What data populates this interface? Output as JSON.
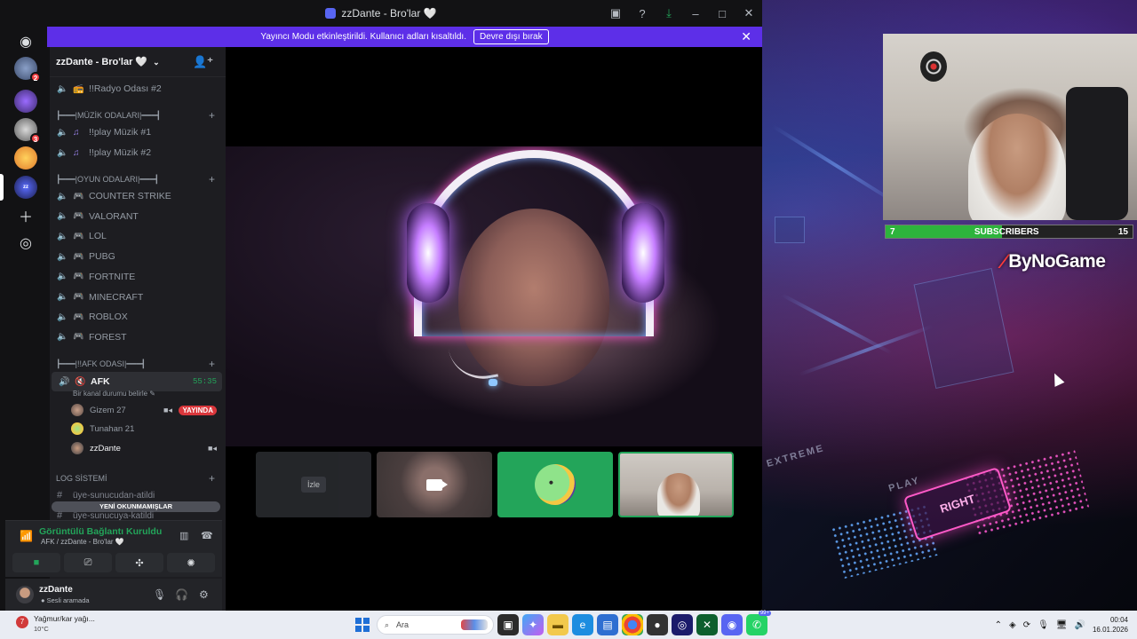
{
  "window": {
    "title": "zzDante - Bro'lar 🤍",
    "controls": [
      "inbox-icon",
      "help-icon",
      "download-icon",
      "minimize-icon",
      "maximize-icon",
      "close-icon"
    ]
  },
  "banner": {
    "message": "Yayıncı Modu etkinleştirildi. Kullanıcı adları kısaltıldı.",
    "button": "Devre dışı bırak",
    "close": "✕"
  },
  "guilds": {
    "items": [
      {
        "name": "server-1",
        "badge": "2"
      },
      {
        "name": "server-2",
        "badge": ""
      },
      {
        "name": "server-3",
        "badge": "3"
      },
      {
        "name": "server-4",
        "badge": ""
      },
      {
        "name": "server-zzdante",
        "badge": ""
      }
    ]
  },
  "server": {
    "name": "zzDante - Bro'lar 🤍",
    "chevron": "⌄"
  },
  "channels": {
    "radyo": "!!Radyo Odası #2",
    "cat_muzik": "┣━━━|MÜZİK ODALARI|━━━┫",
    "muzik1": "!!play Müzik #1",
    "muzik2": "!!play Müzik #2",
    "cat_oyun": "┣━━━|OYUN ODALARI|━━━┫",
    "games": [
      "COUNTER STRIKE",
      "VALORANT",
      "LOL",
      "PUBG",
      "FORTNITE",
      "MINECRAFT",
      "ROBLOX",
      "FOREST"
    ],
    "cat_afk": "┣━━━|!!AFK ODASI|━━━┫",
    "afk": "AFK",
    "afk_timer": "55:35",
    "afk_status": "Bir kanal durumu belirle",
    "voice_users": [
      {
        "name": "Gizem 27",
        "badge": "YAYINDA"
      },
      {
        "name": "Tunahan 21",
        "badge": ""
      },
      {
        "name": "zzDante",
        "badge": ""
      }
    ],
    "cat_log": "LOG SİSTEMİ",
    "log1": "üye-sunucudan-atildi",
    "log2": "üye-sunucuya-katildi",
    "unread": "YENİ OKUNMAMIŞLAR"
  },
  "rtc": {
    "status": "Görüntülü Bağlantı Kuruldu",
    "location": "AFK / zzDante - Bro'lar 🤍"
  },
  "user": {
    "name": "zzDante",
    "status": "Sesli aramada"
  },
  "stage": {
    "tile_watch": "İzle"
  },
  "overlay": {
    "sub_left": "7",
    "sub_label": "SUBSCRIBERS",
    "sub_right": "15",
    "sub_progress": 0.47,
    "brand": "ByNoGame",
    "wall_key": "RIGHT",
    "wall_text1": "EXTREME",
    "wall_text2": "PLAY"
  },
  "taskbar": {
    "weather_line1": "Yağmur/kar yağı...",
    "weather_line2": "10°C",
    "weather_badge": "7",
    "search_placeholder": "Ara",
    "discord_badge": "99+",
    "time": "00:04",
    "date": "16.01.2026"
  },
  "colors": {
    "accent": "#5865f2",
    "banner": "#5d2fe8",
    "online": "#23a55a",
    "live": "#da373c"
  }
}
